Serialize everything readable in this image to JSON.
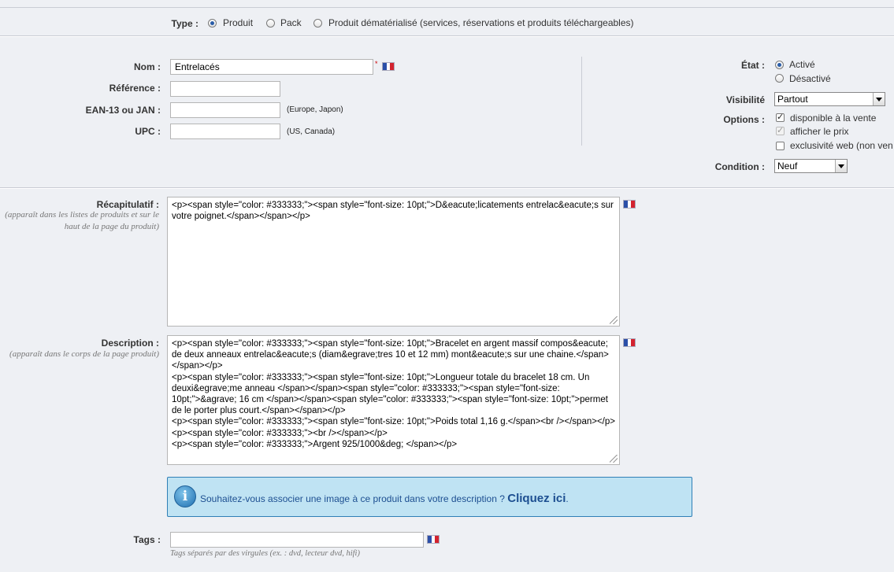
{
  "type_row": {
    "label": "Type :",
    "options": [
      "Produit",
      "Pack",
      "Produit dématérialisé (services, réservations et produits téléchargeables)"
    ]
  },
  "fields": {
    "nom_label": "Nom :",
    "nom_value": "Entrelacés",
    "required_mark": "*",
    "reference_label": "Référence :",
    "reference_value": "",
    "ean_label": "EAN-13 ou JAN :",
    "ean_value": "",
    "ean_hint": "(Europe, Japon)",
    "upc_label": "UPC :",
    "upc_value": "",
    "upc_hint": "(US, Canada)"
  },
  "right_panel": {
    "etat_label": "État :",
    "etat_options": [
      "Activé",
      "Désactivé"
    ],
    "visibilite_label": "Visibilité",
    "visibilite_value": "Partout",
    "options_label": "Options :",
    "options": [
      "disponible à la vente",
      "afficher le prix",
      "exclusivité web (non ven"
    ],
    "condition_label": "Condition :",
    "condition_value": "Neuf"
  },
  "recap": {
    "label": "Récapitulatif :",
    "help": "(apparaît dans les listes de produits et sur le haut de la page du produit)",
    "value": "<p><span style=\"color: #333333;\"><span style=\"font-size: 10pt;\">D&eacute;licatements entrelac&eacute;s sur votre poignet.</span></span></p>"
  },
  "description": {
    "label": "Description :",
    "help": "(apparaît dans le corps de la page produit)",
    "value": "<p><span style=\"color: #333333;\"><span style=\"font-size: 10pt;\">Bracelet en argent massif compos&eacute; de deux anneaux entrelac&eacute;s (diam&egrave;tres 10 et 12 mm) mont&eacute;s sur une chaine.</span></span></p>\n<p><span style=\"color: #333333;\"><span style=\"font-size: 10pt;\">Longueur totale du bracelet 18 cm. Un deuxi&egrave;me anneau </span></span><span style=\"color: #333333;\"><span style=\"font-size: 10pt;\">&agrave; 16 cm </span></span><span style=\"color: #333333;\"><span style=\"font-size: 10pt;\">permet de le porter plus court.</span></span></p>\n<p><span style=\"color: #333333;\"><span style=\"font-size: 10pt;\">Poids total 1,16 g.</span><br /></span></p>\n<p><span style=\"color: #333333;\"><br /></span></p>\n<p><span style=\"color: #333333;\">Argent 925/1000&deg; </span></p>"
  },
  "info_box": {
    "text": "Souhaitez-vous associer une image à ce produit dans votre description ?",
    "link": "Cliquez ici",
    "end": "."
  },
  "tags": {
    "label": "Tags :",
    "value": "",
    "hint": "Tags séparés par des virgules (ex. : dvd, lecteur dvd, hifi)"
  },
  "colors": {
    "flag_blue": "#2b4fa8",
    "flag_white": "#ffffff",
    "flag_red": "#d3232f",
    "info_bg": "#bfe3f3",
    "info_border": "#2f7fb6",
    "link": "#1d4f91"
  }
}
